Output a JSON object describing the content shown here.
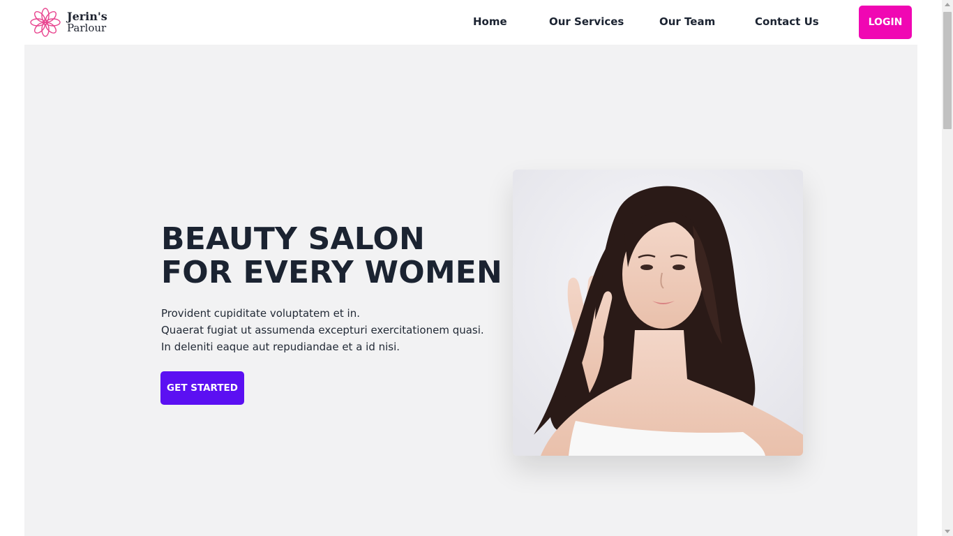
{
  "brand": {
    "name_line1": "Jerin's",
    "name_line2": "Parlour",
    "icon": "lotus-flower-icon",
    "accent_color": "#f007b3"
  },
  "nav": {
    "items": [
      {
        "label": "Home"
      },
      {
        "label": "Our Services"
      },
      {
        "label": "Our Team"
      },
      {
        "label": "Contact Us"
      }
    ],
    "login_label": "LOGIN"
  },
  "hero": {
    "headline_line1": "BEAUTY SALON",
    "headline_line2": "FOR EVERY WOMEN",
    "description": [
      "Provident cupiditate voluptatem et in.",
      "Quaerat fugiat ut assumenda excepturi exercitationem quasi.",
      "In deleniti eaque aut repudiandae et a id nisi."
    ],
    "cta_label": "GET STARTED",
    "cta_color": "#5b10f2",
    "photo_icon": "woman-portrait-photo"
  }
}
